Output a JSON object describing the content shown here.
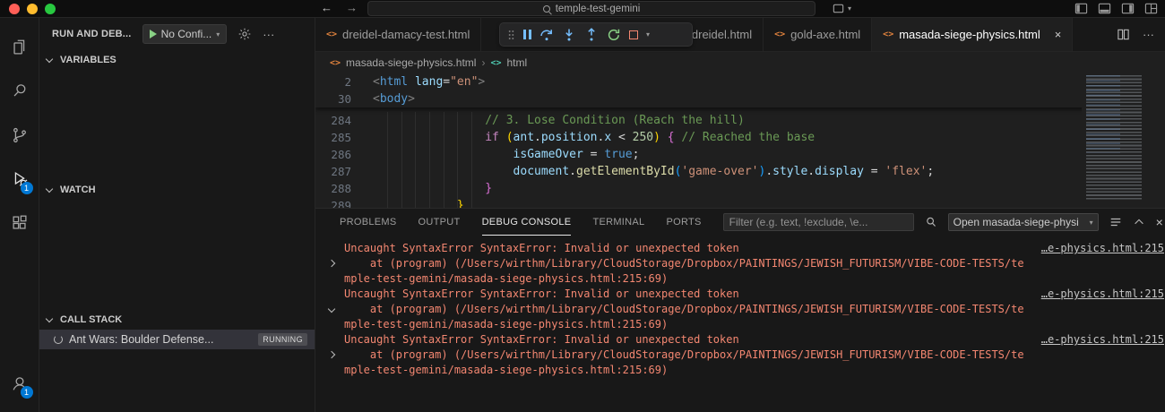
{
  "icons": {
    "back": "←",
    "forward": "→",
    "chevron_down": "▾",
    "ellipsis": "···",
    "close": "×",
    "breadcrumb_sep": "›",
    "file_html": "<>",
    "symbol_html": "<>"
  },
  "titlebar": {
    "command_center": "temple-test-gemini"
  },
  "activity_bar": {
    "debug_badge": "1",
    "account_badge": "1"
  },
  "sidebar": {
    "title": "RUN AND DEB...",
    "config_button": "No Confi...",
    "sections": [
      {
        "label": "VARIABLES"
      },
      {
        "label": "WATCH"
      },
      {
        "label": "CALL STACK"
      }
    ],
    "call_stack_row": {
      "label": "Ant Wars: Boulder Defense...",
      "badge": "RUNNING"
    }
  },
  "editor_tabs": [
    {
      "label": "dreidel-damacy-test.html",
      "active": false
    },
    {
      "label": "3ddreidel.html",
      "active": false
    },
    {
      "label": "gold-axe.html",
      "active": false
    },
    {
      "label": "masada-siege-physics.html",
      "active": true
    }
  ],
  "breadcrumb": {
    "file": "masada-siege-physics.html",
    "symbol": "html"
  },
  "editor": {
    "sticky_lines": [
      {
        "num": "2",
        "indent": 0,
        "tokens": [
          {
            "t": "<",
            "c": "punct"
          },
          {
            "t": "html",
            "c": "tag"
          },
          {
            "t": " ",
            "c": "plain"
          },
          {
            "t": "lang",
            "c": "attr"
          },
          {
            "t": "=",
            "c": "plain"
          },
          {
            "t": "\"en\"",
            "c": "str"
          },
          {
            "t": ">",
            "c": "punct"
          }
        ]
      },
      {
        "num": "30",
        "indent": 0,
        "tokens": [
          {
            "t": "<",
            "c": "punct"
          },
          {
            "t": "body",
            "c": "tag"
          },
          {
            "t": ">",
            "c": "punct"
          }
        ]
      }
    ],
    "lines": [
      {
        "num": "284",
        "indent": 16,
        "tokens": [
          {
            "t": "// 3. Lose Condition (Reach the hill)",
            "c": "cmt"
          }
        ]
      },
      {
        "num": "285",
        "indent": 16,
        "tokens": [
          {
            "t": "if",
            "c": "kw"
          },
          {
            "t": " ",
            "c": "plain"
          },
          {
            "t": "(",
            "c": "p1"
          },
          {
            "t": "ant",
            "c": "var"
          },
          {
            "t": ".",
            "c": "plain"
          },
          {
            "t": "position",
            "c": "var"
          },
          {
            "t": ".",
            "c": "plain"
          },
          {
            "t": "x",
            "c": "var"
          },
          {
            "t": " < ",
            "c": "plain"
          },
          {
            "t": "250",
            "c": "num"
          },
          {
            "t": ")",
            "c": "p1"
          },
          {
            "t": " ",
            "c": "plain"
          },
          {
            "t": "{",
            "c": "p2"
          },
          {
            "t": " ",
            "c": "plain"
          },
          {
            "t": "// Reached the base",
            "c": "cmt"
          }
        ]
      },
      {
        "num": "286",
        "indent": 20,
        "tokens": [
          {
            "t": "isGameOver",
            "c": "var"
          },
          {
            "t": " = ",
            "c": "plain"
          },
          {
            "t": "true",
            "c": "kw2"
          },
          {
            "t": ";",
            "c": "plain"
          }
        ]
      },
      {
        "num": "287",
        "indent": 20,
        "tokens": [
          {
            "t": "document",
            "c": "var"
          },
          {
            "t": ".",
            "c": "plain"
          },
          {
            "t": "getElementById",
            "c": "fn"
          },
          {
            "t": "(",
            "c": "p3"
          },
          {
            "t": "'game-over'",
            "c": "str"
          },
          {
            "t": ")",
            "c": "p3"
          },
          {
            "t": ".",
            "c": "plain"
          },
          {
            "t": "style",
            "c": "var"
          },
          {
            "t": ".",
            "c": "plain"
          },
          {
            "t": "display",
            "c": "var"
          },
          {
            "t": " = ",
            "c": "plain"
          },
          {
            "t": "'flex'",
            "c": "str"
          },
          {
            "t": ";",
            "c": "plain"
          }
        ]
      },
      {
        "num": "288",
        "indent": 16,
        "tokens": [
          {
            "t": "}",
            "c": "p2"
          }
        ]
      },
      {
        "num": "289",
        "indent": 12,
        "tokens": [
          {
            "t": "}",
            "c": "p1"
          }
        ]
      }
    ]
  },
  "panel": {
    "tabs": [
      {
        "label": "PROBLEMS",
        "active": false
      },
      {
        "label": "OUTPUT",
        "active": false
      },
      {
        "label": "DEBUG CONSOLE",
        "active": true
      },
      {
        "label": "TERMINAL",
        "active": false
      },
      {
        "label": "PORTS",
        "active": false
      }
    ],
    "filter_placeholder": "Filter (e.g. text, !exclude, \\e...",
    "console_picker": "Open masada-siege-physi",
    "console": {
      "blocks": [
        {
          "message": "Uncaught SyntaxError SyntaxError: Invalid or unexpected token",
          "link": "…e-physics.html:215",
          "chevron": "right",
          "stack1": "    at (program) (/Users/wirthm/Library/CloudStorage/Dropbox/PAINTINGS/JEWISH_FUTURISM/VIBE-CODE-TESTS/te",
          "stack2": "mple-test-gemini/masada-siege-physics.html:215:69)"
        },
        {
          "message": "Uncaught SyntaxError SyntaxError: Invalid or unexpected token",
          "link": "…e-physics.html:215",
          "chevron": "down",
          "stack1": "    at (program) (/Users/wirthm/Library/CloudStorage/Dropbox/PAINTINGS/JEWISH_FUTURISM/VIBE-CODE-TESTS/te",
          "stack2": "mple-test-gemini/masada-siege-physics.html:215:69)"
        },
        {
          "message": "Uncaught SyntaxError SyntaxError: Invalid or unexpected token",
          "link": "…e-physics.html:215",
          "chevron": "right",
          "stack1": "    at (program) (/Users/wirthm/Library/CloudStorage/Dropbox/PAINTINGS/JEWISH_FUTURISM/VIBE-CODE-TESTS/te",
          "stack2": "mple-test-gemini/masada-siege-physics.html:215:69)"
        }
      ]
    }
  }
}
